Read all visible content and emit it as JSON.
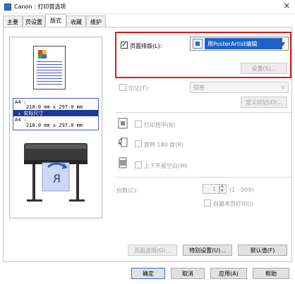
{
  "window": {
    "brand": "Canon",
    "title": "打印首选项",
    "close_glyph": "✕",
    "app_icon": "printer-app-icon"
  },
  "tabs": [
    {
      "label": "主要"
    },
    {
      "label": "页设置"
    },
    {
      "label": "版式",
      "active": true
    },
    {
      "label": "收藏"
    },
    {
      "label": "维护"
    }
  ],
  "preview": {
    "paper_size_label": "A4 :",
    "paper_size_dims": "210.0 mm x 297.0 mm",
    "actual_size_label": "↓ 实际尺寸",
    "output_size_label": "A4 :",
    "output_size_dims": "210.0 mm x 297.0 mm",
    "printer_sheet_letter": "R"
  },
  "page_layout": {
    "checkbox_label": "页面排版(L):",
    "checked": true,
    "select_value": "用PosterArtist编辑",
    "settings_button": "设置(S)..."
  },
  "stamp": {
    "checkbox_label": "印记(T):",
    "select_value": "保密",
    "define_button": "定义印记(D)..."
  },
  "options": {
    "center_label": "打印居中(N)",
    "rotate_label": "旋转 180 度(R)",
    "no_spaces_label": "上下不留空白(M)"
  },
  "copies": {
    "label": "份数(C):",
    "value": "1",
    "range": "(1 - 999)",
    "collate_label": "自最末页打印(I)"
  },
  "bottom_buttons": {
    "page_options": "页面选项(G)...",
    "special_settings": "特别设置(U)...",
    "defaults": "默认值(F)"
  },
  "dialog_buttons": {
    "ok": "确定",
    "cancel": "取消",
    "apply": "应用(A)",
    "help": "帮助"
  },
  "colors": {
    "selection_blue": "#1c63c8",
    "highlight_red": "#d41e1e",
    "size_box_blue": "#1f3796"
  }
}
